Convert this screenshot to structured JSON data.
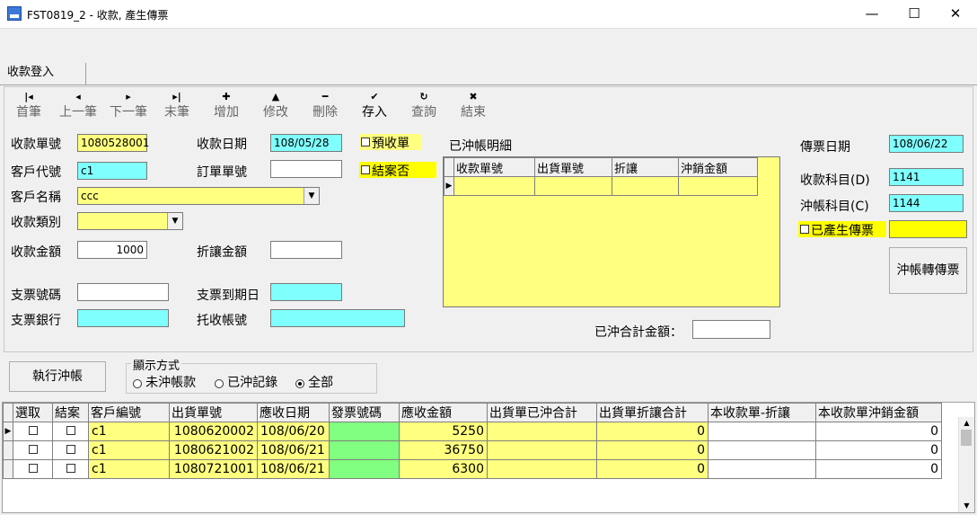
{
  "window": {
    "title": "FST0819_2 - 收款, 產生傳票",
    "minimize": "—",
    "maximize": "☐",
    "close": "✕"
  },
  "tabs": [
    {
      "label": "收款登入"
    }
  ],
  "toolbar": [
    {
      "label": "首筆",
      "icon": "|◂"
    },
    {
      "label": "上一筆",
      "icon": "◂"
    },
    {
      "label": "下一筆",
      "icon": "▸"
    },
    {
      "label": "末筆",
      "icon": "▸|"
    },
    {
      "label": "增加",
      "icon": "✚"
    },
    {
      "label": "修改",
      "icon": "▲"
    },
    {
      "label": "刪除",
      "icon": "━"
    },
    {
      "label": "存入",
      "icon": "✔"
    },
    {
      "label": "查詢",
      "icon": "↻"
    },
    {
      "label": "結束",
      "icon": "✖"
    }
  ],
  "form": {
    "receipt_no_label": "收款單號",
    "receipt_no": "1080528001",
    "receipt_date_label": "收款日期",
    "receipt_date": "108/05/28",
    "prepaid_label": "預收單",
    "customer_code_label": "客戶代號",
    "customer_code": "c1",
    "order_no_label": "訂單單號",
    "order_no": "",
    "closed_label": "結案否",
    "customer_name_label": "客戶名稱",
    "customer_name": "ccc",
    "receipt_type_label": "收款類別",
    "receipt_type": "",
    "amount_label": "收款金額",
    "amount": "1000",
    "discount_label": "折讓金額",
    "discount": "",
    "check_no_label": "支票號碼",
    "check_no": "",
    "check_due_label": "支票到期日",
    "check_due": "",
    "check_bank_label": "支票銀行",
    "check_bank": "",
    "collection_acct_label": "托收帳號",
    "collection_acct": ""
  },
  "offset_detail": {
    "title": "已沖帳明細",
    "columns": [
      "收款單號",
      "出貨單號",
      "折讓",
      "沖銷金額"
    ],
    "total_label": "已沖合計金額：",
    "total_value": ""
  },
  "voucher": {
    "date_label": "傳票日期",
    "date": "108/06/22",
    "debit_label": "收款科目(D)",
    "debit": "1141",
    "credit_label": "沖帳科目(C)",
    "credit": "1144",
    "generated_label": "已產生傳票",
    "generated_value": "",
    "convert_button": "沖帳轉傳票"
  },
  "actions": {
    "execute_button": "執行沖帳"
  },
  "display_mode": {
    "title": "顯示方式",
    "options": [
      {
        "label": "未沖帳款"
      },
      {
        "label": "已沖記錄"
      },
      {
        "label": "全部"
      }
    ],
    "selected": 2
  },
  "grid": {
    "columns": [
      "選取",
      "結案",
      "客戶編號",
      "出貨單號",
      "應收日期",
      "發票號碼",
      "應收金額",
      "出貨單已沖合計",
      "出貨單折讓合計",
      "本收款單-折讓",
      "本收款單沖銷金額"
    ],
    "rows": [
      {
        "customer": "c1",
        "shipment_no": "1080620002",
        "due_date": "108/06/20",
        "invoice_no": "",
        "receivable": "5250",
        "offset_total": "",
        "discount_total": "0",
        "this_discount": "",
        "this_offset": "0"
      },
      {
        "customer": "c1",
        "shipment_no": "1080621002",
        "due_date": "108/06/21",
        "invoice_no": "",
        "receivable": "36750",
        "offset_total": "",
        "discount_total": "0",
        "this_discount": "",
        "this_offset": "0"
      },
      {
        "customer": "c1",
        "shipment_no": "1080721001",
        "due_date": "108/06/21",
        "invoice_no": "",
        "receivable": "6300",
        "offset_total": "",
        "discount_total": "0",
        "this_discount": "",
        "this_offset": "0"
      }
    ]
  },
  "colors": {
    "yellow_field": "#ffff80",
    "cyan_field": "#80ffff",
    "invoice_cell": "#80ff80"
  }
}
